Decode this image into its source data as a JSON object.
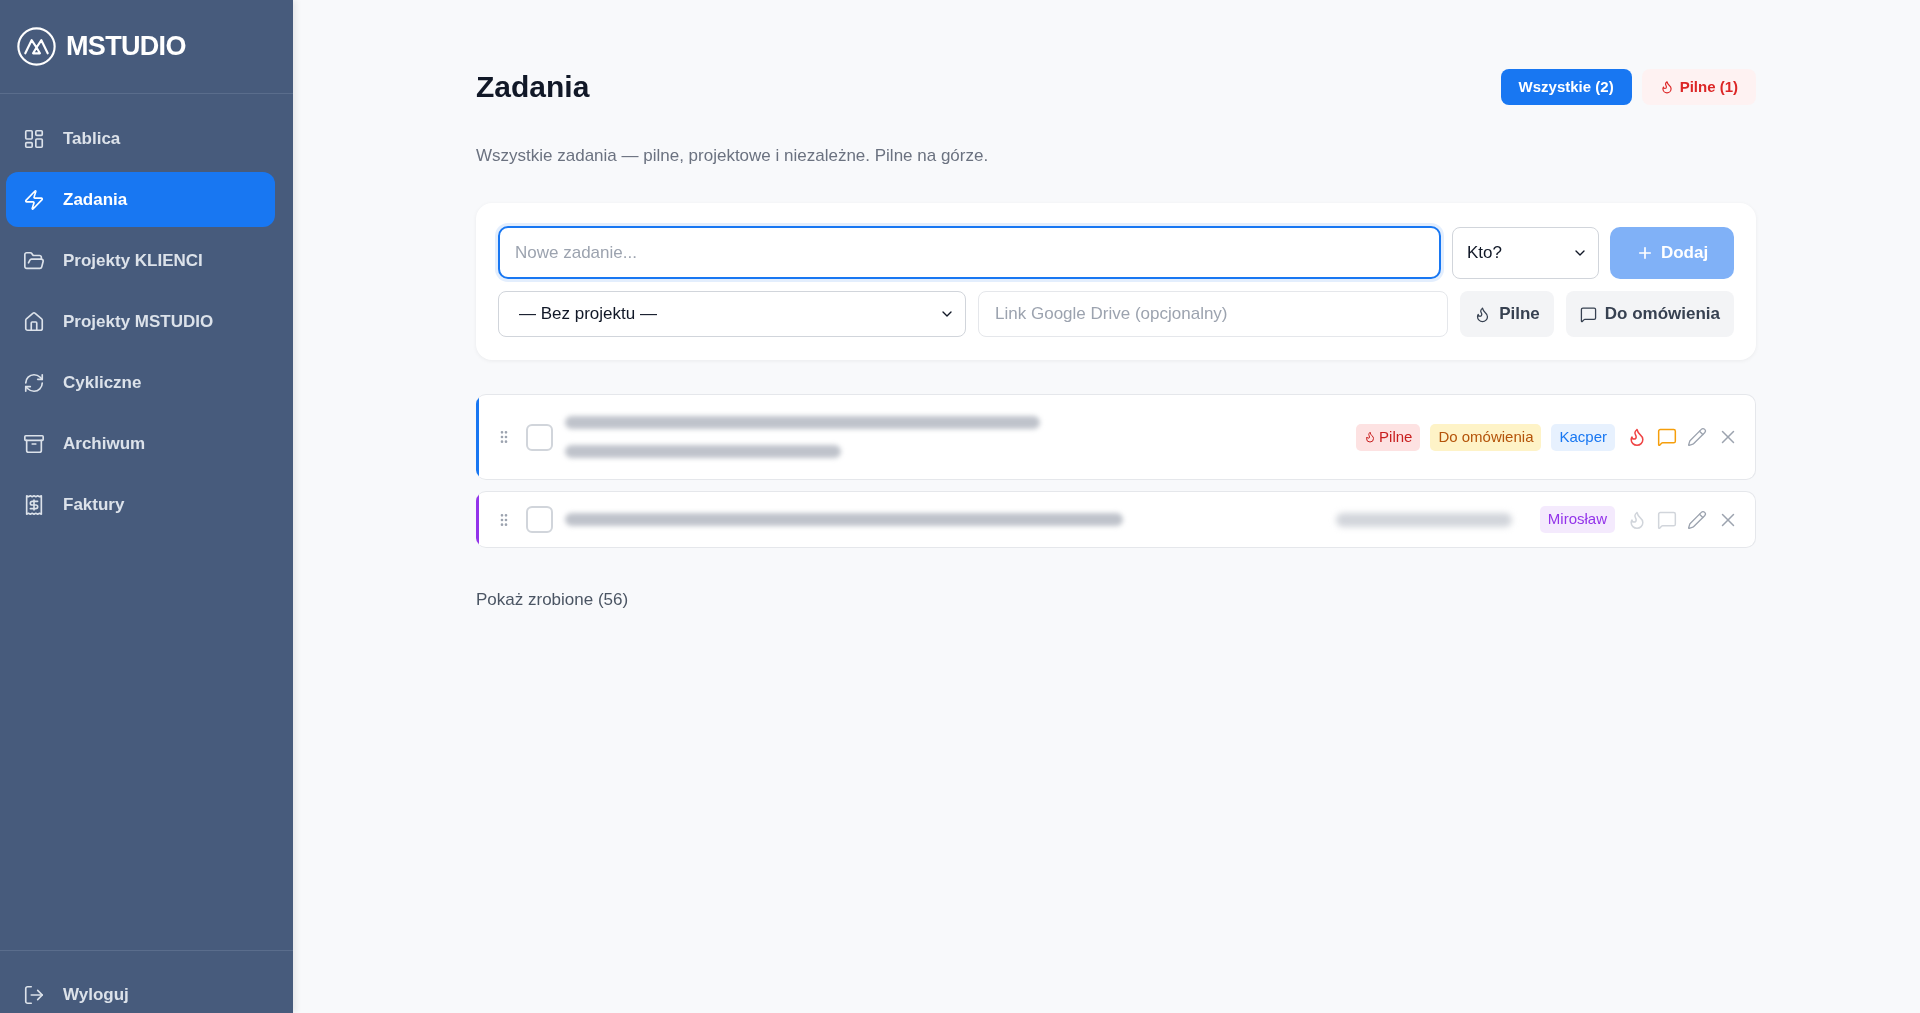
{
  "sidebar": {
    "brand": "MSTUDIO",
    "items": [
      {
        "label": "Tablica",
        "selected": false
      },
      {
        "label": "Zadania",
        "selected": true
      },
      {
        "label": "Projekty KLIENCI",
        "selected": false
      },
      {
        "label": "Projekty MSTUDIO",
        "selected": false
      },
      {
        "label": "Cykliczne",
        "selected": false
      },
      {
        "label": "Archiwum",
        "selected": false
      },
      {
        "label": "Faktury",
        "selected": false
      }
    ],
    "logout": {
      "label": "Wyloguj"
    }
  },
  "header": {
    "title": "Zadania",
    "filters": [
      {
        "kind": "all",
        "label": "Wszystkie (2)",
        "selected": true
      },
      {
        "kind": "urgent",
        "label": "Pilne (1)",
        "selected": false
      }
    ],
    "subtitle": "Wszystkie zadania — pilne, projektowe i niezależne. Pilne na górze."
  },
  "form": {
    "task_field": {
      "placeholder": "Nowe zadanie...",
      "focused": true
    },
    "assignee_select": {
      "value": "Kto?"
    },
    "add_button": {
      "label": "Dodaj",
      "disabled": true
    },
    "project_select": {
      "value": "— Bez projektu —"
    },
    "link_field": {
      "placeholder": "Link Google Drive (opcjonalny)"
    },
    "urgent_toggle": {
      "label": "Pilne",
      "on": false
    },
    "discuss_toggle": {
      "label": "Do omówienia",
      "on": false
    }
  },
  "tasks": [
    {
      "checked": false,
      "color": "#1877f2",
      "title_lines": [
        {
          "kind": "redacted"
        },
        {
          "kind": "redacted"
        }
      ],
      "tags": [
        {
          "kind": "urgent",
          "label": "Pilne"
        },
        {
          "kind": "discuss",
          "label": "Do omówienia"
        },
        {
          "kind": "assignee",
          "label": "Kacper"
        }
      ],
      "urgent": true,
      "discuss": true
    },
    {
      "checked": false,
      "color": "#9333ea",
      "title_lines": [
        {
          "kind": "redacted"
        }
      ],
      "tags": [
        {
          "kind": "redacted"
        },
        {
          "kind": "assignee",
          "label": "Mirosław"
        }
      ],
      "urgent": false,
      "discuss": false
    }
  ],
  "show_done": {
    "label": "Pokaż zrobione (56)"
  }
}
